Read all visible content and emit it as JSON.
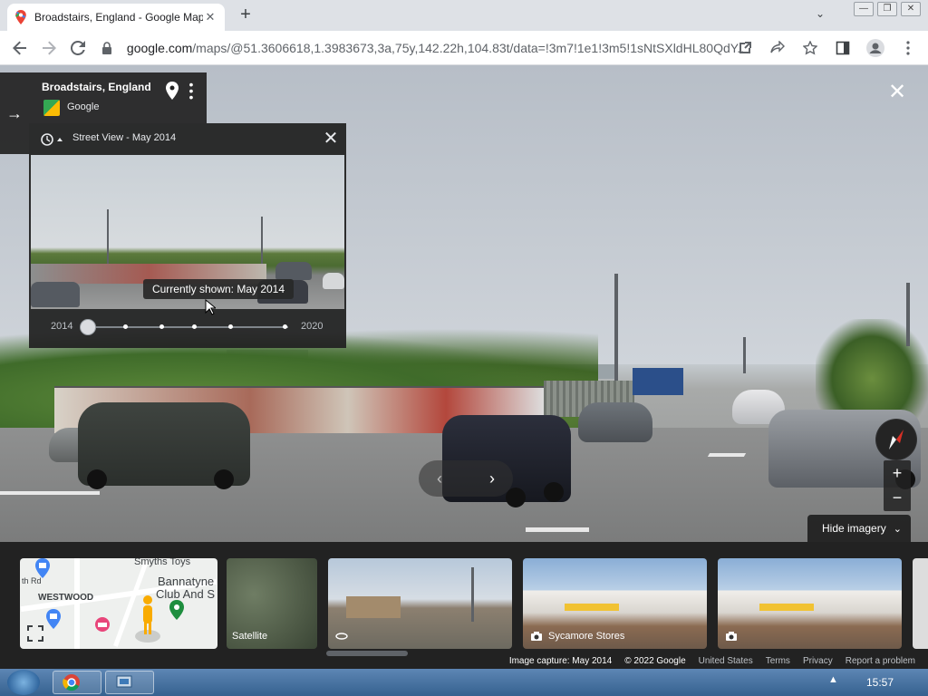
{
  "browser": {
    "tab_title": "Broadstairs, England - Google Maps",
    "tab_close": "✕",
    "new_tab": "+",
    "tab_search": "⌄",
    "window_buttons": [
      "—",
      "❐",
      "✕"
    ],
    "url_host": "google.com",
    "url_path": "/maps/@51.3606618,1.3983673,3a,75y,142.22h,104.83t/data=!3m7!1e1!3m5!1sNtSXldHL80QdY..."
  },
  "place": {
    "title": "Broadstairs, England",
    "source": "Google"
  },
  "time_machine": {
    "title": "Street View - May 2014",
    "tooltip": "Currently shown: May 2014",
    "year_start": "2014",
    "year_end": "2020",
    "selected_fraction": 0.0
  },
  "controls": {
    "hide_imagery": "Hide imagery",
    "zoom_in": "+",
    "zoom_out": "−",
    "close": "✕",
    "prev": "‹",
    "next": "›",
    "collapse": "→"
  },
  "filmstrip": {
    "map_labels": [
      "Smyths Toys",
      "Bannatyne",
      "Club And S",
      "WESTWOOD",
      "th Rd"
    ],
    "satellite": "Satellite",
    "store_caption": "Sycamore Stores"
  },
  "footer": {
    "capture": "Image capture: May 2014",
    "copyright": "© 2022 Google",
    "links": [
      "United States",
      "Terms",
      "Privacy",
      "Report a problem"
    ]
  },
  "taskbar": {
    "time": "15:57",
    "tray_up": "▲"
  },
  "colors": {
    "panel": "#222222",
    "accent_marker": "#f9ab00"
  }
}
